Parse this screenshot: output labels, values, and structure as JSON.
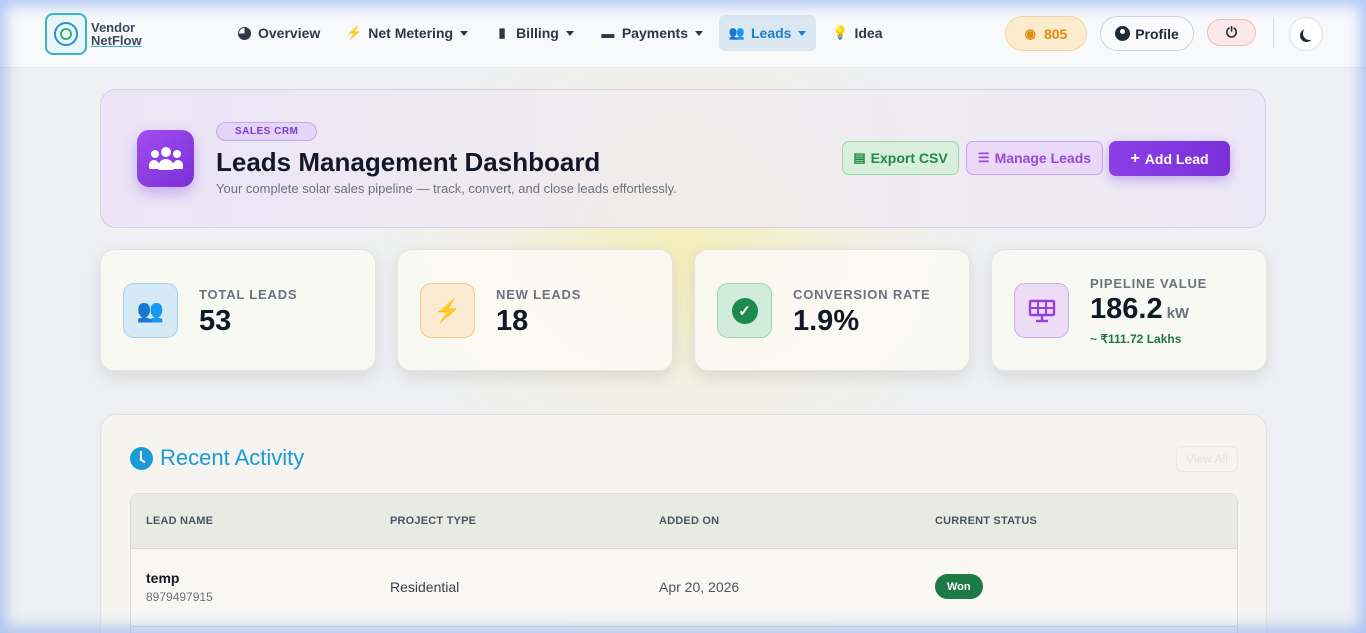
{
  "brand": {
    "line1": "Vendor",
    "line2": "NetFlow"
  },
  "nav": {
    "items": [
      {
        "label": "Overview",
        "icon": "pie-chart-icon",
        "has_caret": false,
        "active": false
      },
      {
        "label": "Net Metering",
        "icon": "bolt-icon",
        "has_caret": true,
        "active": false
      },
      {
        "label": "Billing",
        "icon": "invoice-icon",
        "has_caret": true,
        "active": false
      },
      {
        "label": "Payments",
        "icon": "wallet-icon",
        "has_caret": true,
        "active": false
      },
      {
        "label": "Leads",
        "icon": "users-icon",
        "has_caret": true,
        "active": true
      },
      {
        "label": "Idea",
        "icon": "lightbulb-icon",
        "has_caret": false,
        "active": false
      }
    ],
    "coins": "805",
    "profile_label": "Profile"
  },
  "hero": {
    "badge": "SALES CRM",
    "title": "Leads Management Dashboard",
    "subtitle": "Your complete solar sales pipeline — track, convert, and close leads effortlessly.",
    "export_label": "Export CSV",
    "manage_label": "Manage Leads",
    "add_label": "Add Lead"
  },
  "stats": {
    "total": {
      "label": "TOTAL LEADS",
      "value": "53"
    },
    "new": {
      "label": "NEW LEADS",
      "value": "18"
    },
    "conversion": {
      "label": "CONVERSION RATE",
      "value": "1.9%"
    },
    "pipeline": {
      "label": "PIPELINE VALUE",
      "value": "186.2",
      "unit": "kW",
      "sub": "~ ₹111.72 Lakhs"
    }
  },
  "activity": {
    "title": "Recent Activity",
    "view_all": "View All",
    "columns": [
      "LEAD NAME",
      "PROJECT TYPE",
      "ADDED ON",
      "CURRENT STATUS"
    ],
    "rows": [
      {
        "name": "temp",
        "phone": "8979497915",
        "project_type": "Residential",
        "added_on": "Apr 20, 2026",
        "status": "Won"
      }
    ]
  },
  "colors": {
    "accent_purple": "#8b3fe8",
    "accent_blue": "#1a9ad6",
    "status_won": "#1d7a45",
    "coins": "#e08a0b"
  }
}
